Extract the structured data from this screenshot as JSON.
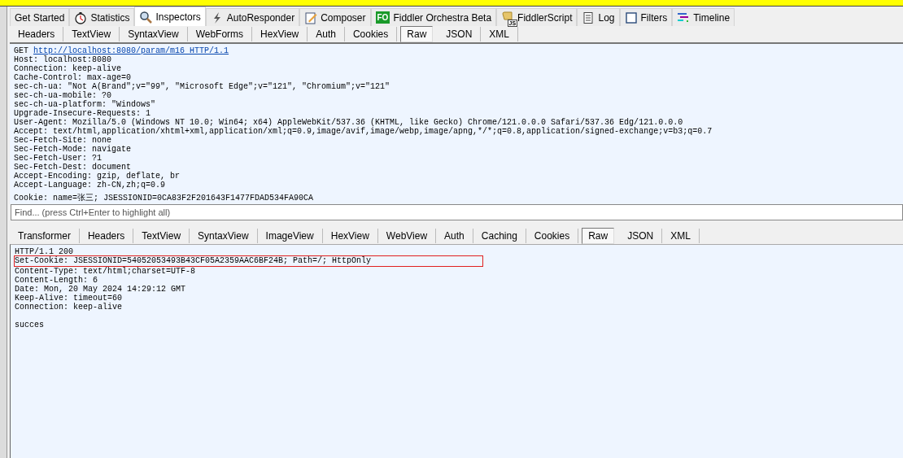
{
  "main_tabs": [
    {
      "label": "Get Started",
      "selected": false
    },
    {
      "label": "Statistics",
      "selected": false
    },
    {
      "label": "Inspectors",
      "selected": true
    },
    {
      "label": "AutoResponder",
      "selected": false
    },
    {
      "label": "Composer",
      "selected": false
    },
    {
      "label": "Fiddler Orchestra Beta",
      "badge": "FO",
      "selected": false
    },
    {
      "label": "FiddlerScript",
      "badge": "JS",
      "selected": false
    },
    {
      "label": "Log",
      "selected": false
    },
    {
      "label": "Filters",
      "selected": false
    },
    {
      "label": "Timeline",
      "selected": false
    }
  ],
  "request": {
    "tabs": [
      {
        "label": "Headers",
        "selected": false
      },
      {
        "label": "TextView",
        "selected": false
      },
      {
        "label": "SyntaxView",
        "selected": false
      },
      {
        "label": "WebForms",
        "selected": false
      },
      {
        "label": "HexView",
        "selected": false
      },
      {
        "label": "Auth",
        "selected": false
      },
      {
        "label": "Cookies",
        "selected": false
      },
      {
        "label": "Raw",
        "selected": true
      },
      {
        "label": "JSON",
        "selected": false
      },
      {
        "label": "XML",
        "selected": false
      }
    ],
    "method": "GET",
    "url": "http://localhost:8080/param/m16 HTTP/1.1",
    "lines": [
      "Host: localhost:8080",
      "Connection: keep-alive",
      "Cache-Control: max-age=0",
      "sec-ch-ua: \"Not A(Brand\";v=\"99\", \"Microsoft Edge\";v=\"121\", \"Chromium\";v=\"121\"",
      "sec-ch-ua-mobile: ?0",
      "sec-ch-ua-platform: \"Windows\"",
      "Upgrade-Insecure-Requests: 1",
      "User-Agent: Mozilla/5.0 (Windows NT 10.0; Win64; x64) AppleWebKit/537.36 (KHTML, like Gecko) Chrome/121.0.0.0 Safari/537.36 Edg/121.0.0.0",
      "Accept: text/html,application/xhtml+xml,application/xml;q=0.9,image/avif,image/webp,image/apng,*/*;q=0.8,application/signed-exchange;v=b3;q=0.7",
      "Sec-Fetch-Site: none",
      "Sec-Fetch-Mode: navigate",
      "Sec-Fetch-User: ?1",
      "Sec-Fetch-Dest: document",
      "Accept-Encoding: gzip, deflate, br",
      "Accept-Language: zh-CN,zh;q=0.9"
    ],
    "cookie_line": "Cookie: name=张三; JSESSIONID=0CA83F2F201643F1477FDAD534FA90CA",
    "find": {
      "placeholder": "Find... (press Ctrl+Enter to highlight all)"
    }
  },
  "response": {
    "tabs": [
      {
        "label": "Transformer",
        "selected": false
      },
      {
        "label": "Headers",
        "selected": false
      },
      {
        "label": "TextView",
        "selected": false
      },
      {
        "label": "SyntaxView",
        "selected": false
      },
      {
        "label": "ImageView",
        "selected": false
      },
      {
        "label": "HexView",
        "selected": false
      },
      {
        "label": "WebView",
        "selected": false
      },
      {
        "label": "Auth",
        "selected": false
      },
      {
        "label": "Caching",
        "selected": false
      },
      {
        "label": "Cookies",
        "selected": false
      },
      {
        "label": "Raw",
        "selected": true
      },
      {
        "label": "JSON",
        "selected": false
      },
      {
        "label": "XML",
        "selected": false
      }
    ],
    "lines": [
      {
        "text": "HTTP/1.1 200",
        "highlighted": false
      },
      {
        "text": "Set-Cookie: JSESSIONID=54052053493B43CF05A2359AAC6BF24B; Path=/; HttpOnly",
        "highlighted": true
      },
      {
        "text": "Content-Type: text/html;charset=UTF-8",
        "highlighted": false
      },
      {
        "text": "Content-Length: 6",
        "highlighted": false
      },
      {
        "text": "Date: Mon, 20 May 2024 14:29:12 GMT",
        "highlighted": false
      },
      {
        "text": "Keep-Alive: timeout=60",
        "highlighted": false
      },
      {
        "text": "Connection: keep-alive",
        "highlighted": false
      }
    ],
    "body": "succes"
  }
}
